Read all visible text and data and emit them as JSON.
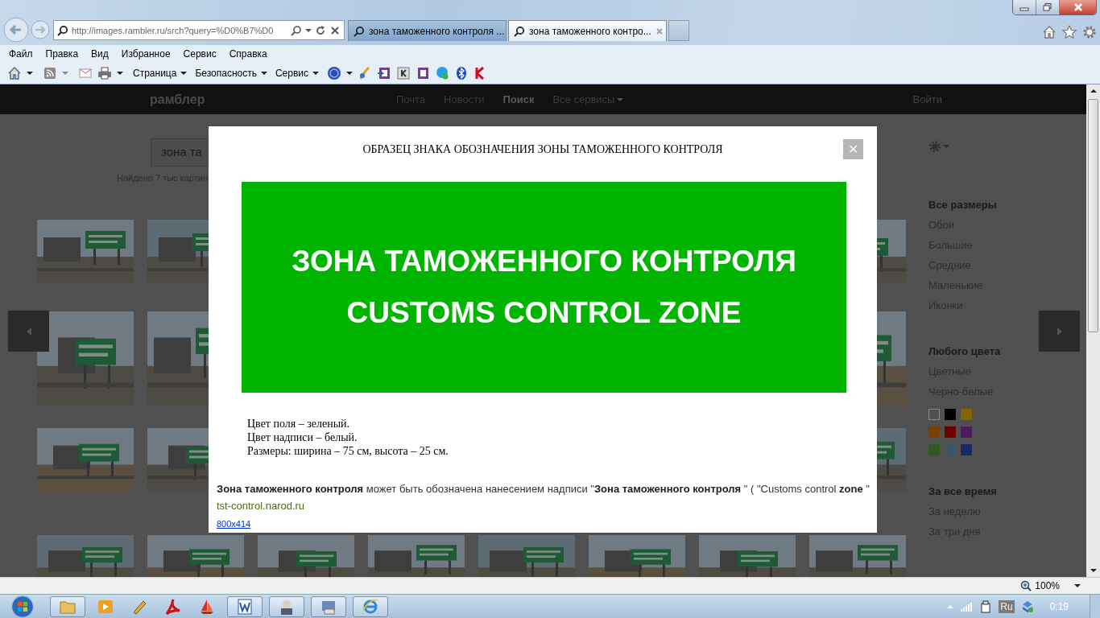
{
  "browser": {
    "address": "http://images.rambler.ru/srch?query=%D0%B7%D0",
    "tabs": [
      {
        "title": "зона таможенного контроля ...",
        "selected": false
      },
      {
        "title": "зона таможенного контро...",
        "selected": true
      }
    ],
    "menu": [
      "Файл",
      "Правка",
      "Вид",
      "Избранное",
      "Сервис",
      "Справка"
    ],
    "commands": [
      "Страница",
      "Безопасность",
      "Сервис"
    ],
    "zoom": "100%"
  },
  "page": {
    "logo": "рамблер",
    "nav": [
      {
        "label": "Почта",
        "selected": false,
        "dropdown": false
      },
      {
        "label": "Новости",
        "selected": false,
        "dropdown": false
      },
      {
        "label": "Поиск",
        "selected": true,
        "dropdown": false
      },
      {
        "label": "Все сервисы",
        "selected": false,
        "dropdown": true
      }
    ],
    "login": "Войти",
    "search": {
      "value": "зона та"
    },
    "found": "Найдено 7 тыс картин",
    "filters": [
      {
        "items": [
          {
            "label": "Все размеры",
            "selected": true
          },
          {
            "label": "Обои",
            "selected": false
          },
          {
            "label": "Большие",
            "selected": false
          },
          {
            "label": "Средние",
            "selected": false
          },
          {
            "label": "Маленькие",
            "selected": false
          },
          {
            "label": "Иконки",
            "selected": false
          }
        ]
      },
      {
        "items": [
          {
            "label": "Любого цвета",
            "selected": true
          },
          {
            "label": "Цветные",
            "selected": false
          },
          {
            "label": "Черно-белые",
            "selected": false
          }
        ],
        "swatches": [
          {
            "kind": "outline",
            "color": "#8a8a8a"
          },
          {
            "kind": "fill",
            "color": "#000000"
          },
          {
            "kind": "fill",
            "color": "#7f6500"
          },
          {
            "kind": "fill",
            "color": "#7a4000"
          },
          {
            "kind": "fill",
            "color": "#6a0000"
          },
          {
            "kind": "fill",
            "color": "#4d1a5c"
          },
          {
            "kind": "fill",
            "color": "#2e5b22"
          },
          {
            "kind": "fill",
            "color": "#3a5664"
          },
          {
            "kind": "fill",
            "color": "#1c2866"
          }
        ]
      },
      {
        "items": [
          {
            "label": "За все время",
            "selected": true
          },
          {
            "label": "За неделю",
            "selected": false
          },
          {
            "label": "За три дня",
            "selected": false
          }
        ]
      }
    ]
  },
  "modal": {
    "title": "ОБРАЗЕЦ ЗНАКА ОБОЗНАЧЕНИЯ ЗОНЫ ТАМОЖЕННОГО КОНТРОЛЯ",
    "close": "×",
    "sign_lines": [
      "ЗОНА ТАМОЖЕННОГО КОНТРОЛЯ",
      "CUSTOMS CONTROL ZONE"
    ],
    "caption": [
      "Цвет поля – зеленый.",
      "Цвет надписи – белый.",
      "Размеры: ширина – 75 см, высота – 25 см."
    ],
    "description": "**Зона таможенного контроля** может быть обозначена нанесением надписи \"**Зона таможенного контроля** \" ( \"Customs control **zone** \"",
    "source": "tst-control.narod.ru",
    "size": "800x414"
  },
  "taskbar": {
    "language": "Ru",
    "time": "0:19"
  }
}
